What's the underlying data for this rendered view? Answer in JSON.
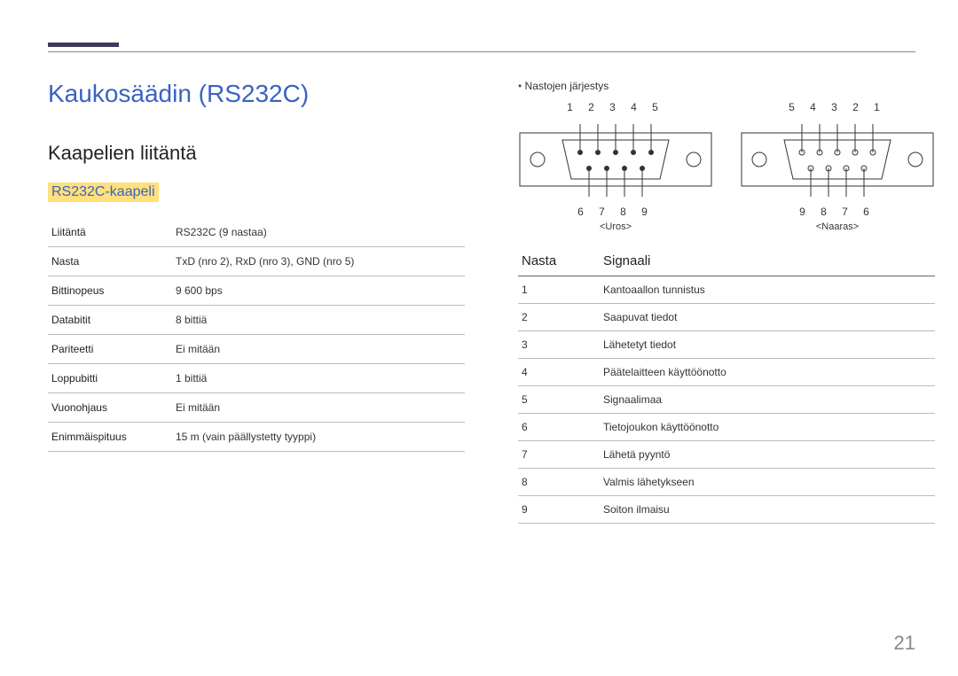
{
  "heading": "Kaukosäädin (RS232C)",
  "subheading": "Kaapelien liitäntä",
  "highlight": "RS232C-kaapeli",
  "spec_rows": [
    {
      "k": "Liitäntä",
      "v": "RS232C (9 nastaa)"
    },
    {
      "k": "Nasta",
      "v": "TxD (nro 2), RxD (nro 3), GND (nro 5)"
    },
    {
      "k": "Bittinopeus",
      "v": "9 600 bps"
    },
    {
      "k": "Databitit",
      "v": "8 bittiä"
    },
    {
      "k": "Pariteetti",
      "v": "Ei mitään"
    },
    {
      "k": "Loppubitti",
      "v": "1 bittiä"
    },
    {
      "k": "Vuonohjaus",
      "v": "Ei mitään"
    },
    {
      "k": "Enimmäispituus",
      "v": "15 m (vain päällystetty tyyppi)"
    }
  ],
  "right": {
    "bullet": "Nastojen järjestys",
    "conn_male": {
      "top": "1 2 3 4 5",
      "bottom": "6 7 8 9",
      "caption": "<Uros>"
    },
    "conn_female": {
      "top": "5 4 3 2 1",
      "bottom": "9 8 7 6",
      "caption": "<Naaras>"
    },
    "pin_head_nasta": "Nasta",
    "pin_head_sig": "Signaali",
    "pins": [
      {
        "n": "1",
        "s": "Kantoaallon tunnistus"
      },
      {
        "n": "2",
        "s": "Saapuvat tiedot"
      },
      {
        "n": "3",
        "s": "Lähetetyt tiedot"
      },
      {
        "n": "4",
        "s": "Päätelaitteen käyttöönotto"
      },
      {
        "n": "5",
        "s": "Signaalimaa"
      },
      {
        "n": "6",
        "s": "Tietojoukon käyttöönotto"
      },
      {
        "n": "7",
        "s": "Lähetä pyyntö"
      },
      {
        "n": "8",
        "s": "Valmis lähetykseen"
      },
      {
        "n": "9",
        "s": "Soiton ilmaisu"
      }
    ]
  },
  "page_number": "21"
}
